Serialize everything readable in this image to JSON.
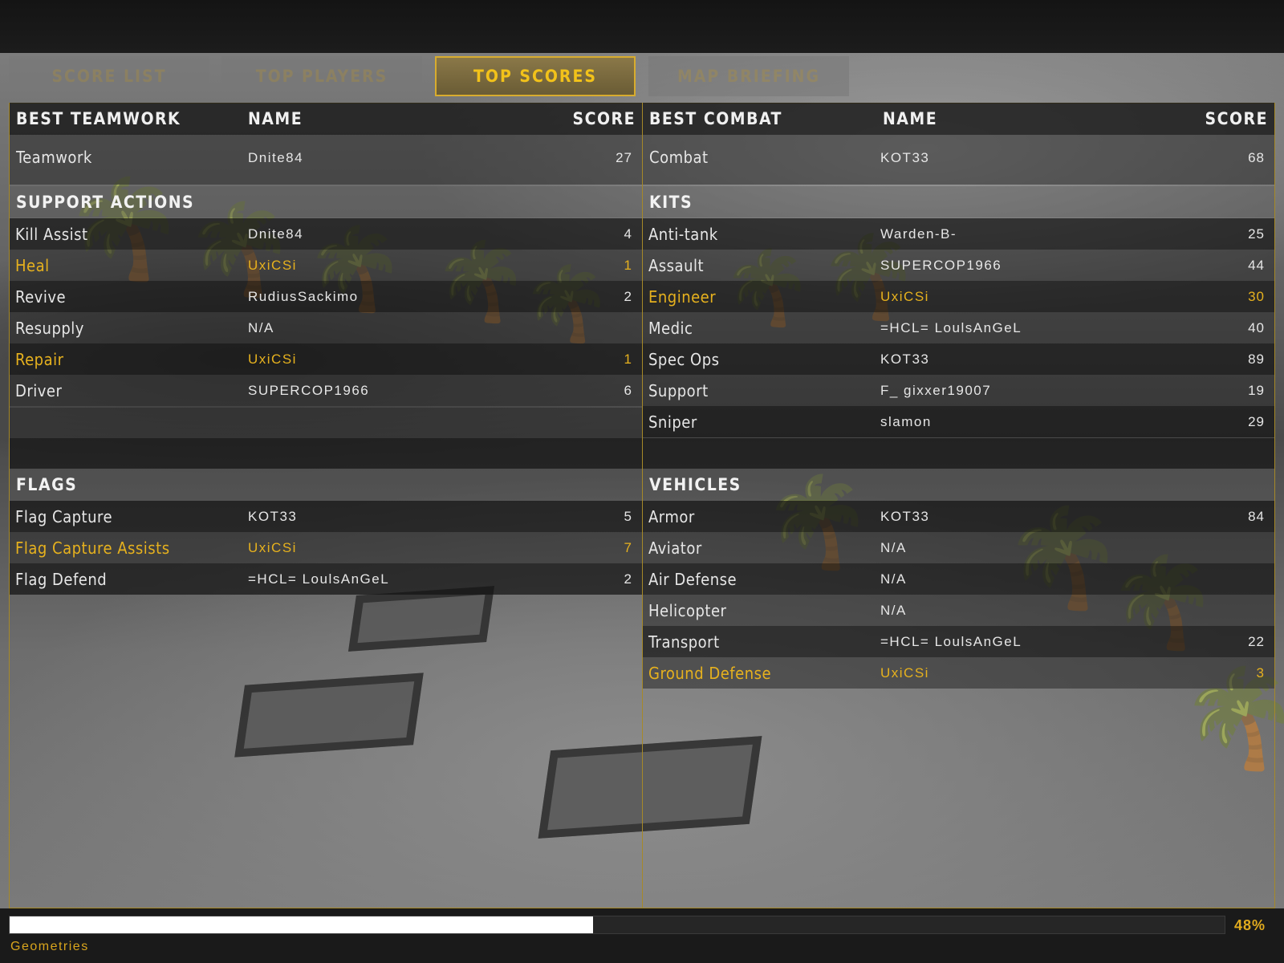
{
  "tabs": [
    {
      "label": "SCORE LIST",
      "active": false
    },
    {
      "label": "TOP PLAYERS",
      "active": false
    },
    {
      "label": "TOP SCORES",
      "active": true
    },
    {
      "label": "MAP BRIEFING",
      "active": false
    }
  ],
  "left": {
    "header": {
      "category": "BEST TEAMWORK",
      "name": "NAME",
      "score": "SCORE"
    },
    "top_row": {
      "label": "Teamwork",
      "name": "Dnite84",
      "score": "27"
    },
    "support": {
      "title": "SUPPORT ACTIONS",
      "rows": [
        {
          "label": "Kill Assist",
          "name": "Dnite84",
          "score": "4",
          "highlight": false
        },
        {
          "label": "Heal",
          "name": "UxiCSi",
          "score": "1",
          "highlight": true
        },
        {
          "label": "Revive",
          "name": "RudiusSackimo",
          "score": "2",
          "highlight": false
        },
        {
          "label": "Resupply",
          "name": "N/A",
          "score": "",
          "highlight": false
        },
        {
          "label": "Repair",
          "name": "UxiCSi",
          "score": "1",
          "highlight": true
        },
        {
          "label": "Driver",
          "name": "SUPERCOP1966",
          "score": "6",
          "highlight": false
        }
      ]
    },
    "flags": {
      "title": "FLAGS",
      "rows": [
        {
          "label": "Flag Capture",
          "name": "KOT33",
          "score": "5",
          "highlight": false
        },
        {
          "label": "Flag Capture Assists",
          "name": "UxiCSi",
          "score": "7",
          "highlight": true
        },
        {
          "label": "Flag Defend",
          "name": "=HCL= LoulsAnGeL",
          "score": "2",
          "highlight": false
        }
      ]
    }
  },
  "right": {
    "header": {
      "category": "BEST COMBAT",
      "name": "NAME",
      "score": "SCORE"
    },
    "top_row": {
      "label": "Combat",
      "name": "KOT33",
      "score": "68"
    },
    "kits": {
      "title": "KITS",
      "rows": [
        {
          "label": "Anti-tank",
          "name": "Warden-B-",
          "score": "25",
          "highlight": false
        },
        {
          "label": "Assault",
          "name": "SUPERCOP1966",
          "score": "44",
          "highlight": false
        },
        {
          "label": "Engineer",
          "name": "UxiCSi",
          "score": "30",
          "highlight": true
        },
        {
          "label": "Medic",
          "name": "=HCL= LoulsAnGeL",
          "score": "40",
          "highlight": false
        },
        {
          "label": "Spec Ops",
          "name": "KOT33",
          "score": "89",
          "highlight": false
        },
        {
          "label": "Support",
          "name": "F_ gixxer19007",
          "score": "19",
          "highlight": false
        },
        {
          "label": "Sniper",
          "name": "slamon",
          "score": "29",
          "highlight": false
        }
      ]
    },
    "vehicles": {
      "title": "VEHICLES",
      "rows": [
        {
          "label": "Armor",
          "name": "KOT33",
          "score": "84",
          "highlight": false
        },
        {
          "label": "Aviator",
          "name": "N/A",
          "score": "",
          "highlight": false
        },
        {
          "label": "Air Defense",
          "name": "N/A",
          "score": "",
          "highlight": false
        },
        {
          "label": "Helicopter",
          "name": "N/A",
          "score": "",
          "highlight": false
        },
        {
          "label": "Transport",
          "name": "=HCL= LoulsAnGeL",
          "score": "22",
          "highlight": false
        },
        {
          "label": "Ground Defense",
          "name": "UxiCSi",
          "score": "3",
          "highlight": true
        }
      ]
    }
  },
  "loading": {
    "progress": 0.48,
    "percent_label": "48%",
    "status": "Geometries"
  },
  "colors": {
    "accent": "#e6b11e",
    "border": "#a68928",
    "text": "#e6e6e6"
  }
}
